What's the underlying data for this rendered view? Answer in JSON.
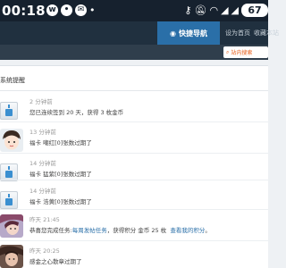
{
  "statusbar": {
    "time": "00:18",
    "left_icons": [
      "weibo-icon",
      "chat-icon",
      "message-icon",
      "more-dots-icon"
    ],
    "right_icons": [
      "key-icon",
      "mute-icon",
      "wifi-icon",
      "signal-icon",
      "signal-icon"
    ],
    "battery": "67"
  },
  "nav": {
    "quick_label": "快捷导航",
    "links": [
      "设为首页",
      "收藏本站"
    ]
  },
  "search": {
    "label": "站内搜索"
  },
  "panel": {
    "title": "系统提醒"
  },
  "notices": [
    {
      "time": "2 分钟前",
      "text": "您已连续签到 20 天，获得 3 枚金币",
      "icon": "system-notice-icon"
    },
    {
      "time": "13 分钟前",
      "text": "福卡 嘲红[0]张数过期了",
      "icon": "avatar"
    },
    {
      "time": "14 分钟前",
      "text": "福卡 猛紫[0]张数过期了",
      "icon": "system-notice-icon"
    },
    {
      "time": "14 分钟前",
      "text": "福卡 浩黄[0]张数过期了",
      "icon": "system-notice-icon"
    },
    {
      "time": "昨天 21:45",
      "text_before": "恭喜您完成任务:",
      "task_link": "每周发帖任务",
      "text_middle": "，获得积分 金币 25 枚",
      "view_link": "查看我的积分",
      "text_after": "。",
      "icon": "avatar"
    },
    {
      "time": "昨天 20:25",
      "text": "感金之心散章过期了",
      "icon": "avatar"
    }
  ],
  "colors": {
    "statusbar_bg": "#16212e",
    "nav_bg": "#20303f",
    "nav_accent": "#2a6fa8",
    "link": "#2a6fa8",
    "search_text": "#e8601c"
  }
}
